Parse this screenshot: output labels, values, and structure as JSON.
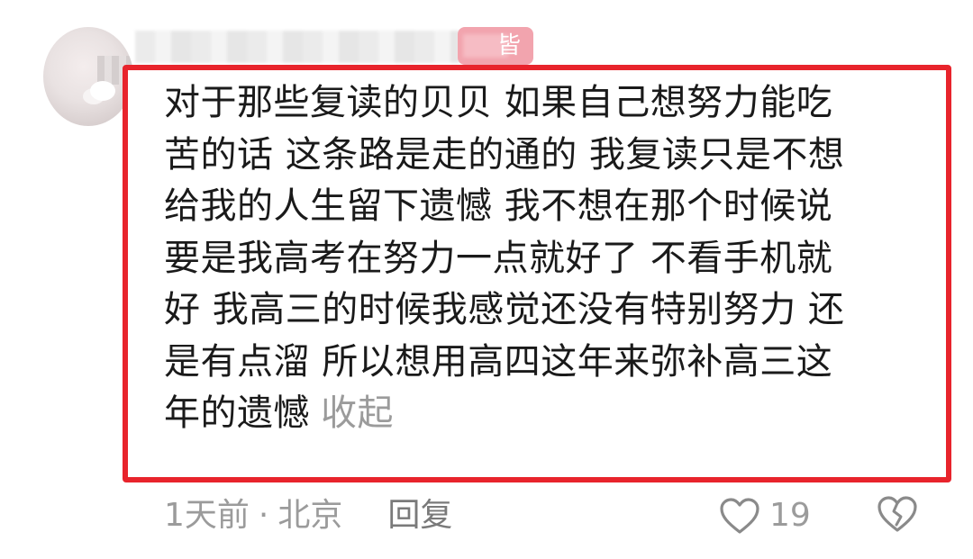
{
  "comment": {
    "user": {
      "badge_text": "皆"
    },
    "text_lines": [
      "对于那些复读的贝贝 如果自己想努力能吃",
      "苦的话 这条路是走的通的 我复读只是不想",
      "给我的人生留下遗憾 我不想在那个时候说",
      "要是我高考在努力一点就好了 不看手机就",
      "好 我高三的时候我感觉还没有特别努力 还",
      "是有点溜 所以想用高四这年来弥补高三这",
      "年的遗憾"
    ],
    "collapse_label": "收起",
    "time": "1天前",
    "separator": "·",
    "location": "北京",
    "reply_label": "回复",
    "like_count": "19",
    "icons": {
      "like": "heart-outline-icon",
      "dislike": "broken-heart-icon"
    },
    "colors": {
      "highlight": "#e8242c",
      "badge": "#f2a4ae",
      "meta_text": "#9b9b9b"
    }
  }
}
